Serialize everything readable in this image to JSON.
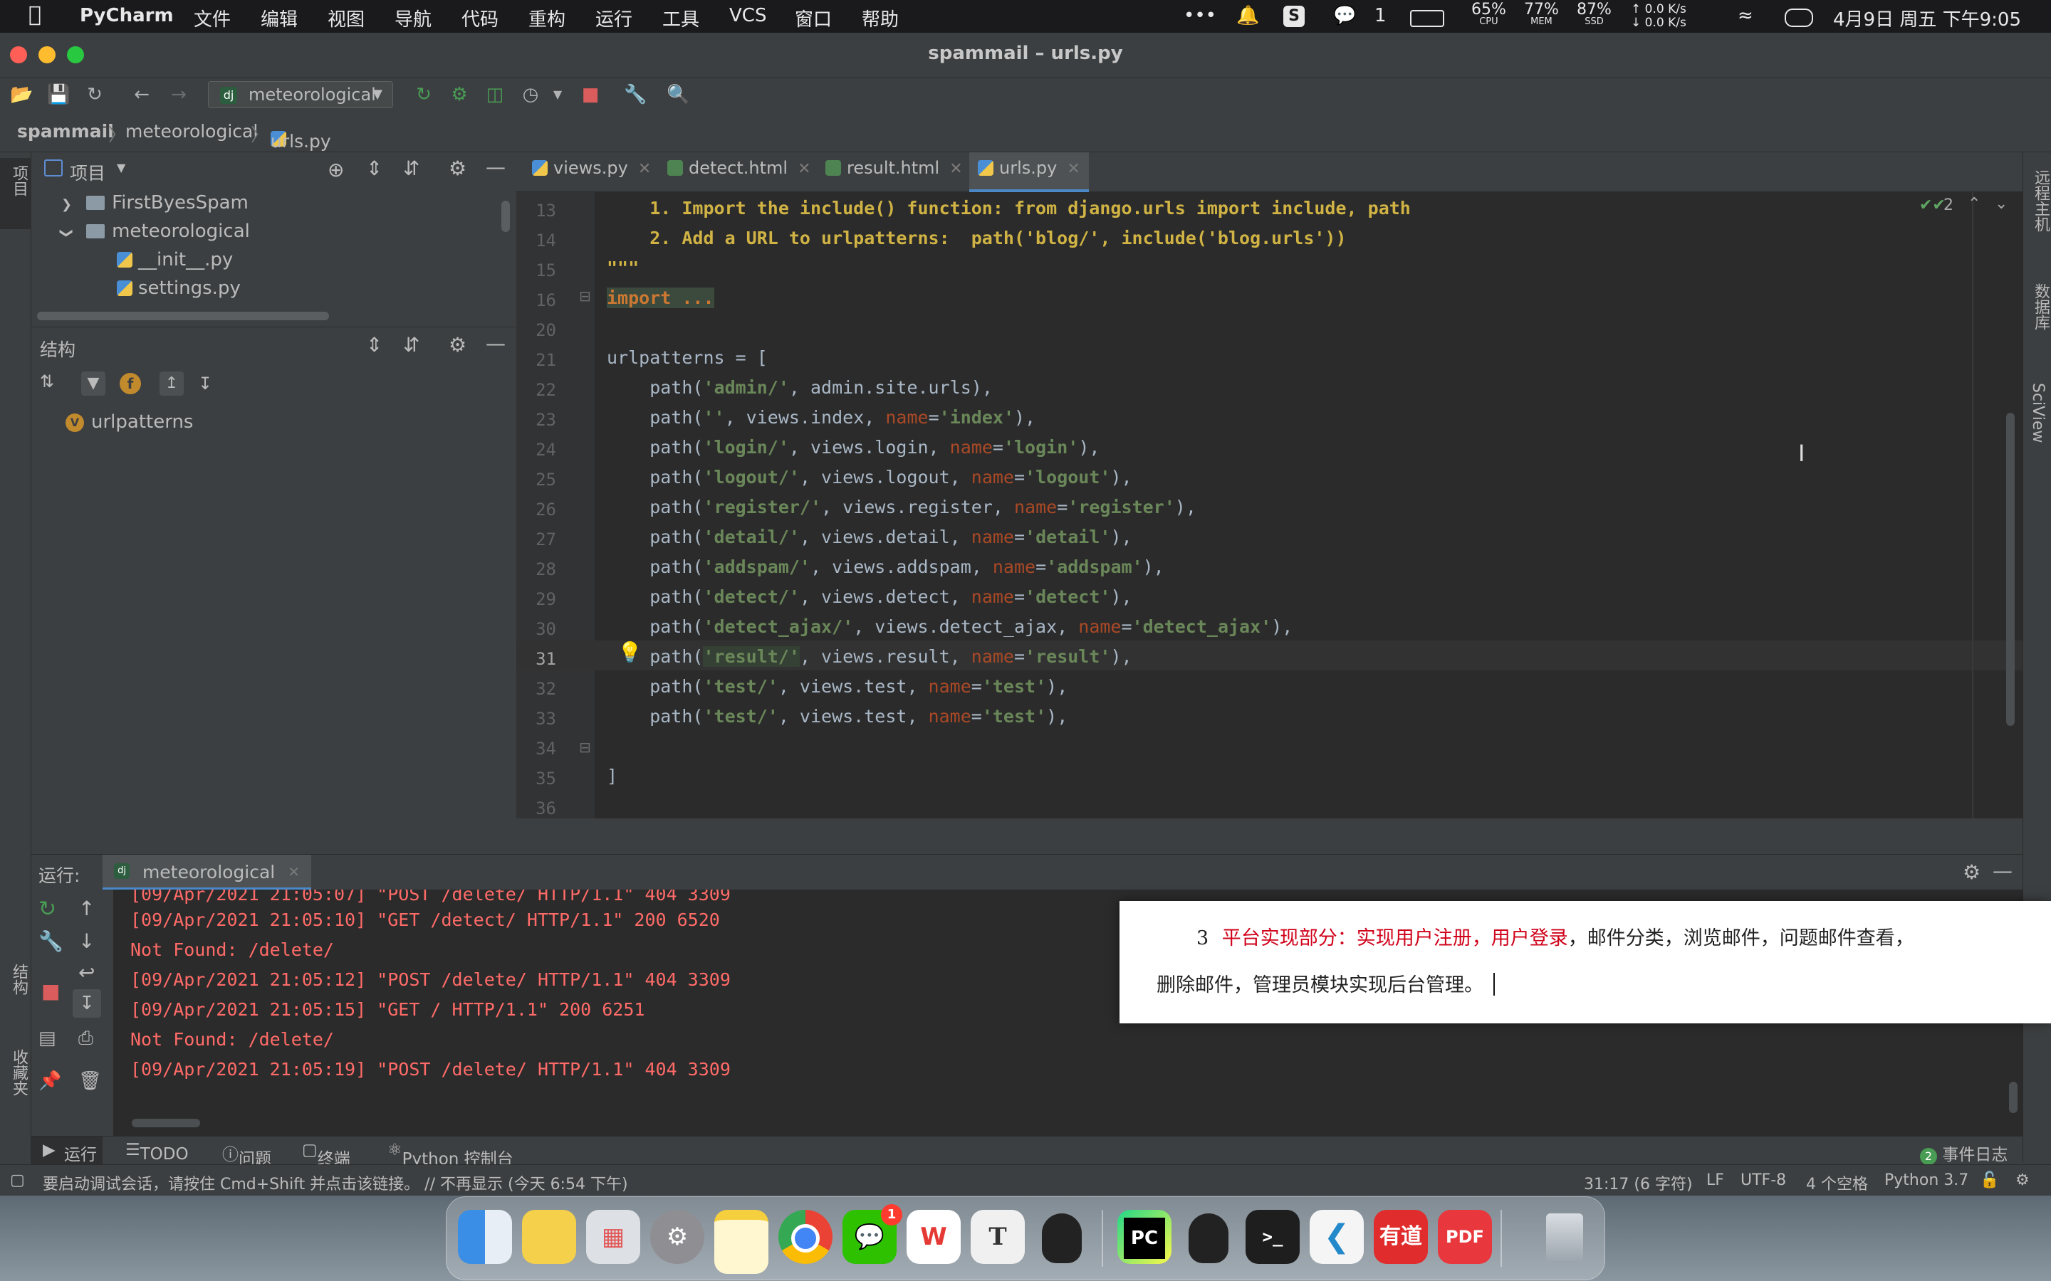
{
  "menubar": {
    "app": "PyCharm",
    "items": [
      "文件",
      "编辑",
      "视图",
      "导航",
      "代码",
      "重构",
      "运行",
      "工具",
      "VCS",
      "窗口",
      "帮助"
    ],
    "wechat_count": "1",
    "cpu": "65%",
    "cpu_label": "CPU",
    "mem": "77%",
    "mem_label": "MEM",
    "ssd": "87%",
    "ssd_label": "SSD",
    "net_up": "0.0 K/s",
    "net_down": "0.0 K/s",
    "datetime": "4月9日 周五 下午9:05"
  },
  "window": {
    "title": "spammail – urls.py"
  },
  "toolbar": {
    "run_config": "meteorological"
  },
  "breadcrumb": {
    "project": "spammail",
    "folder": "meteorological",
    "file": "urls.py"
  },
  "left_stripe": {
    "project": "项目",
    "structure": "结构",
    "favorites": "收藏夹"
  },
  "project_panel": {
    "title": "项目",
    "items": [
      {
        "label": "FirstByesSpam"
      },
      {
        "label": "meteorological"
      },
      {
        "label": "__init__.py"
      },
      {
        "label": "settings.py"
      }
    ]
  },
  "structure_panel": {
    "title": "结构",
    "item": "urlpatterns",
    "item_badge": "V"
  },
  "tabs": [
    {
      "label": "views.py"
    },
    {
      "label": "detect.html"
    },
    {
      "label": "result.html"
    },
    {
      "label": "urls.py"
    }
  ],
  "editor": {
    "check_count": "2",
    "lines": [
      {
        "n": "13",
        "text": "    1. Import the include() function: from django.urls import include, path"
      },
      {
        "n": "14",
        "text": "    2. Add a URL to urlpatterns:  path('blog/', include('blog.urls'))"
      },
      {
        "n": "15",
        "text": "\"\"\""
      },
      {
        "n": "16",
        "text": "import ..."
      },
      {
        "n": "20",
        "text": ""
      },
      {
        "n": "21",
        "text": "urlpatterns = ["
      },
      {
        "n": "22",
        "text": "    path('admin/', admin.site.urls),"
      },
      {
        "n": "23",
        "text": "    path('', views.index, name='index'),"
      },
      {
        "n": "24",
        "text": "    path('login/', views.login, name='login'),"
      },
      {
        "n": "25",
        "text": "    path('logout/', views.logout, name='logout'),"
      },
      {
        "n": "26",
        "text": "    path('register/', views.register, name='register'),"
      },
      {
        "n": "27",
        "text": "    path('detail/', views.detail, name='detail'),"
      },
      {
        "n": "28",
        "text": "    path('addspam/', views.addspam, name='addspam'),"
      },
      {
        "n": "29",
        "text": "    path('detect/', views.detect, name='detect'),"
      },
      {
        "n": "30",
        "text": "    path('detect_ajax/', views.detect_ajax, name='detect_ajax'),"
      },
      {
        "n": "31",
        "text": "    path('result/', views.result, name='result'),"
      },
      {
        "n": "32",
        "text": "    path('test/', views.test, name='test'),"
      },
      {
        "n": "33",
        "text": "    path('test/', views.test, name='test'),"
      },
      {
        "n": "34",
        "text": ""
      },
      {
        "n": "35",
        "text": "]"
      },
      {
        "n": "36",
        "text": ""
      }
    ]
  },
  "right_stripe": {
    "remote": "远程主机",
    "database": "数据库",
    "sciview": "SciView"
  },
  "run_panel": {
    "label": "运行:",
    "config": "meteorological",
    "console": [
      "[09/Apr/2021 21:05:07] \"POST /delete/ HTTP/1.1\" 404 3309",
      "[09/Apr/2021 21:05:10] \"GET /detect/ HTTP/1.1\" 200 6520",
      "Not Found: /delete/",
      "[09/Apr/2021 21:05:12] \"POST /delete/ HTTP/1.1\" 404 3309",
      "[09/Apr/2021 21:05:15] \"GET / HTTP/1.1\" 200 6251",
      "Not Found: /delete/",
      "[09/Apr/2021 21:05:19] \"POST /delete/ HTTP/1.1\" 404 3309"
    ]
  },
  "popup": {
    "num": "3",
    "red": "平台实现部分：实现用户注册，用户登录",
    "rest1": "，邮件分类，浏览邮件，问题邮件查看，",
    "line2": "删除邮件，管理员模块实现后台管理。"
  },
  "bottom_tabs": {
    "run": "运行",
    "todo": "TODO",
    "problems": "问题",
    "terminal": "终端",
    "python_console": "Python 控制台",
    "event_count": "2",
    "event_log": "事件日志"
  },
  "statusbar": {
    "message": "要启动调试会话，请按住 Cmd+Shift 并点击该链接。 // 不再显示 (今天 6:54 下午)",
    "position": "31:17 (6 字符)",
    "line_sep": "LF",
    "encoding": "UTF-8",
    "indent": "4 个空格",
    "interpreter": "Python 3.7"
  },
  "dock": {
    "apps": [
      "finder-icon",
      "notes-icon",
      "launchpad-icon",
      "settings-icon",
      "memo-icon",
      "chrome-icon",
      "wechat-icon",
      "wps-icon",
      "typora-icon",
      "qq-icon",
      "pycharm-icon",
      "qq2-icon",
      "terminal-icon",
      "vscode-icon",
      "youdao-icon",
      "pdf-icon",
      "trash-icon"
    ],
    "wechat_badge": "1",
    "pycharm_label": "PC",
    "youdao_label": "有道",
    "pdf_label": "PDF",
    "typora_label": "T",
    "terminal_label": ">_"
  },
  "colors": {
    "accent": "#4a88c7",
    "string": "#6a8759",
    "keyword_arg": "#aa4926",
    "docstring": "#d0b344",
    "console_error": "#ff6b68",
    "popup_red": "#d0021b"
  }
}
